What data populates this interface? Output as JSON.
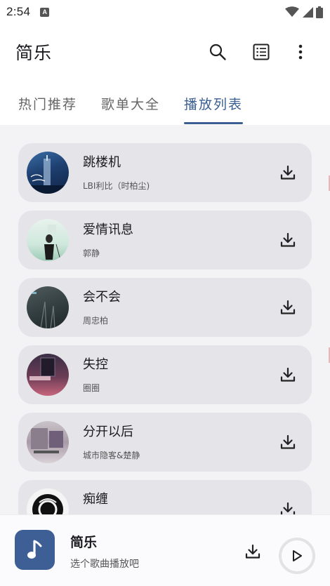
{
  "status": {
    "time": "2:54",
    "notification_letter": "A"
  },
  "app": {
    "title": "简乐"
  },
  "tabs": [
    {
      "label": "热门推荐",
      "active": false
    },
    {
      "label": "歌单大全",
      "active": false
    },
    {
      "label": "播放列表",
      "active": true
    }
  ],
  "songs": [
    {
      "title": "跳楼机",
      "artist": "LBI利比（时柏尘)"
    },
    {
      "title": "爱情讯息",
      "artist": "郭静"
    },
    {
      "title": "会不会",
      "artist": "周忠柏"
    },
    {
      "title": "失控",
      "artist": "圈圈"
    },
    {
      "title": "分开以后",
      "artist": "城市隐客&楚静"
    },
    {
      "title": "痴缠",
      "artist": ""
    }
  ],
  "player": {
    "title": "简乐",
    "subtitle": "选个歌曲播放吧",
    "art_icon": "music-note-icon"
  },
  "colors": {
    "accent": "#3b5f92",
    "card": "#e4e4e9",
    "list_bg": "#f3f3f5"
  }
}
